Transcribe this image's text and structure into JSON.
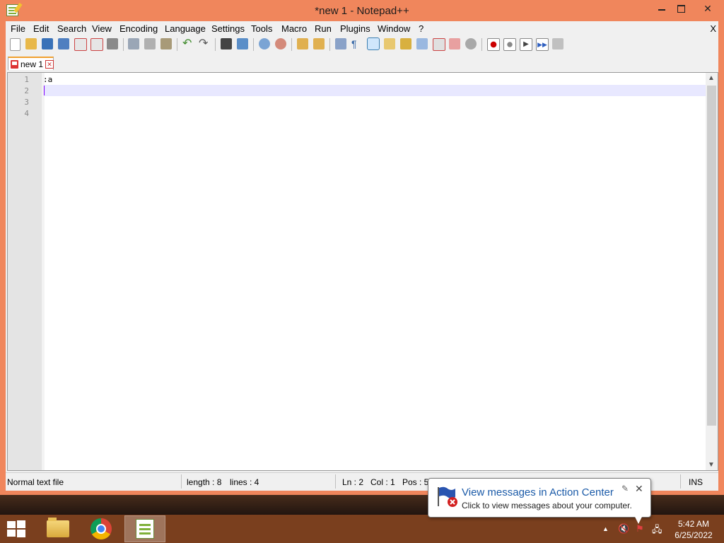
{
  "window": {
    "title": "*new 1 - Notepad++"
  },
  "menu": [
    "File",
    "Edit",
    "Search",
    "View",
    "Encoding",
    "Language",
    "Settings",
    "Tools",
    "Macro",
    "Run",
    "Plugins",
    "Window",
    "?"
  ],
  "menu_close": "X",
  "tab": {
    "label": "new 1"
  },
  "editor": {
    "line_numbers": [
      "1",
      "2",
      "3",
      "4"
    ],
    "lines": [
      ":a",
      "",
      "",
      ""
    ]
  },
  "status": {
    "file_type": "Normal text file",
    "length": "length : 8",
    "lines": "lines : 4",
    "ln": "Ln : 2",
    "col": "Col : 1",
    "pos": "Pos : 5",
    "ins": "INS"
  },
  "notification": {
    "title": "View messages in Action Center",
    "text": "Click to view messages about your computer."
  },
  "clock": {
    "time": "5:42 AM",
    "date": "6/25/2022"
  },
  "colors": {
    "window_frame": "#f0865c",
    "taskbar": "#7a3f1e",
    "current_line": "#e8e8ff"
  }
}
